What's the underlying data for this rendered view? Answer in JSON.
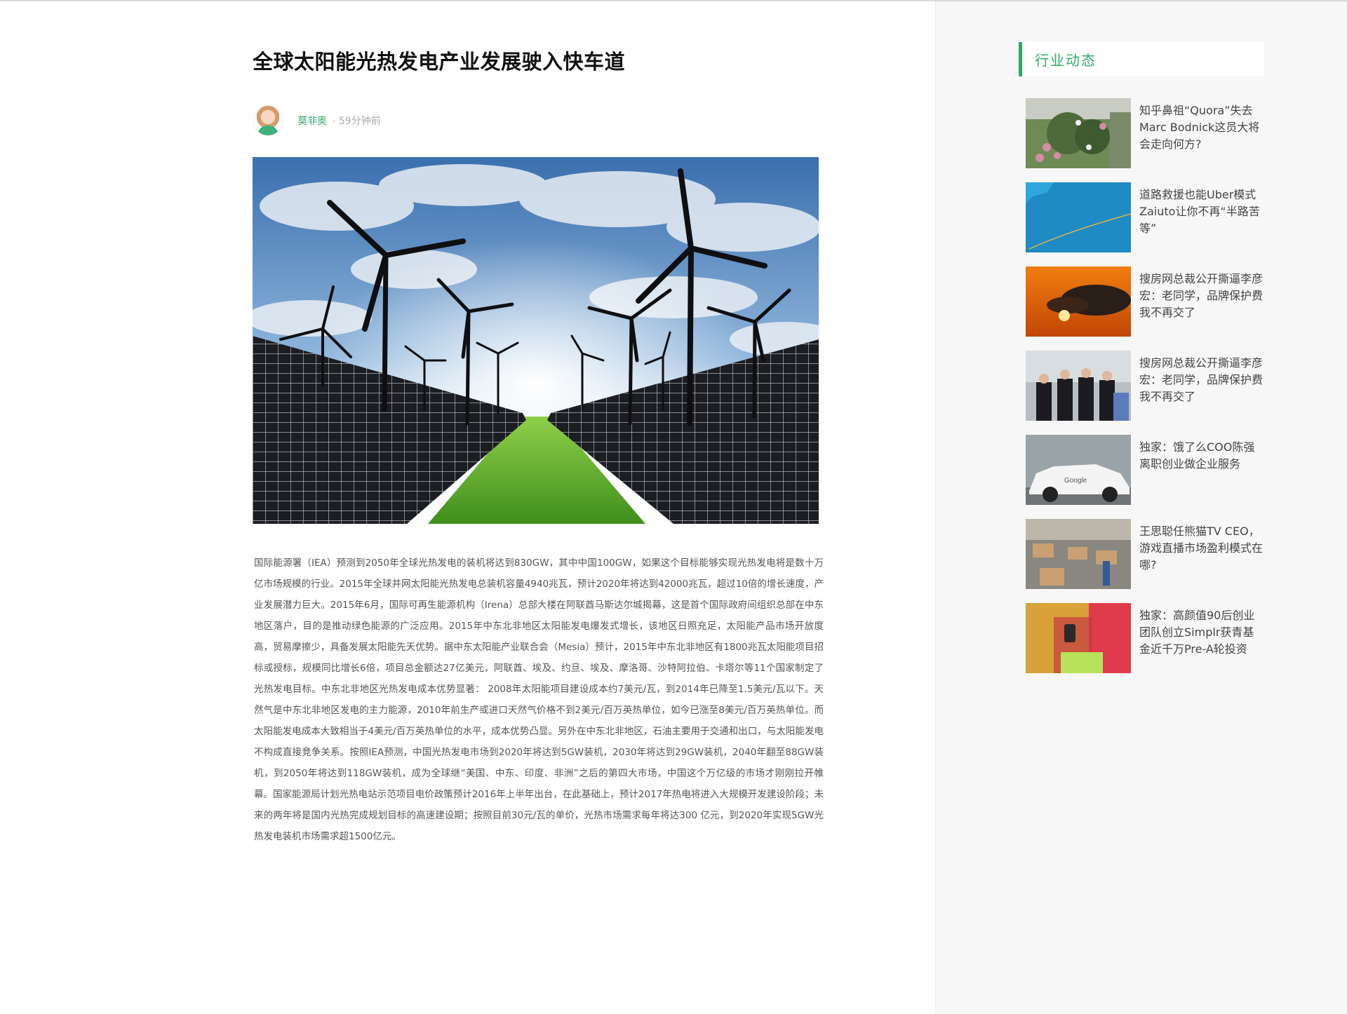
{
  "article": {
    "title": "全球太阳能光热发电产业发展驶入快车道",
    "author": "莫非奥",
    "time": "· 59分钟前",
    "body": "国际能源署（IEA）预测到2050年全球光热发电的装机将达到830GW，其中中国100GW，如果这个目标能够实现光热发电将是数十万亿市场规模的行业。2015年全球并网太阳能光热发电总装机容量4940兆瓦，预计2020年将达到42000兆瓦，超过10倍的增长速度，产业发展潜力巨大。2015年6月，国际可再生能源机构（Irena）总部大楼在阿联酋马斯达尔城揭幕，这是首个国际政府间组织总部在中东地区落户，目的是推动绿色能源的广泛应用。2015年中东北非地区太阳能发电爆发式增长，该地区日照充足，太阳能产品市场开放度高，贸易摩擦少，具备发展太阳能先天优势。据中东太阳能产业联合会（Mesia）预计，2015年中东北非地区有1800兆瓦太阳能项目招标或授标，规模同比增长6倍，项目总金额达27亿美元，阿联酋、埃及、约旦、埃及、摩洛哥、沙特阿拉伯、卡塔尔等11个国家制定了光热发电目标。中东北非地区光热发电成本优势显著： 2008年太阳能项目建设成本约7美元/瓦，到2014年已降至1.5美元/瓦以下。天然气是中东北非地区发电的主力能源，2010年前生产或进口天然气价格不到2美元/百万英热单位，如今已涨至8美元/百万英热单位。而太阳能发电成本大致相当于4美元/百万英热单位的水平，成本优势凸显。另外在中东北非地区，石油主要用于交通和出口，与太阳能发电不构成直接竞争关系。按照IEA预测，中国光热发电市场到2020年将达到5GW装机，2030年将达到29GW装机，2040年翻至88GW装机，到2050年将达到118GW装机，成为全球继“美国、中东、印度、非洲”之后的第四大市场，中国这个万亿级的市场才刚刚拉开帷幕。国家能源局计划光热电站示范项目电价政策预计2016年上半年出台，在此基础上，预计2017年热电将进入大规模开发建设阶段；未来的两年将是国内光热完成规划目标的高速建设期；按照目前30元/瓦的单价，光热市场需求每年将达300 亿元，到2020年实现5GW光热发电装机市场需求超1500亿元。"
  },
  "sidebar": {
    "section_title": "行业动态",
    "items": [
      {
        "title": "知乎鼻祖“Quora”失去Marc Bodnick这员大将会走向何方?",
        "thumb": "flowers"
      },
      {
        "title": "道路救援也能Uber模式 Zaiuto让你不再“半路苦等”",
        "thumb": "map-blue"
      },
      {
        "title": "搜房网总裁公开撕逼李彦宏：老同学，品牌保护费我不再交了",
        "thumb": "sunset"
      },
      {
        "title": "搜房网总裁公开撕逼李彦宏：老同学，品牌保护费我不再交了",
        "thumb": "group-photo"
      },
      {
        "title": "独家：饿了么COO陈强离职创业做企业服务",
        "thumb": "google-car"
      },
      {
        "title": "王思聪任熊猫TV CEO，游戏直播市场盈利模式在哪?",
        "thumb": "warehouse"
      },
      {
        "title": "独家：高颜值90后创业团队创立Simplr获青基金近千万Pre-A轮投资",
        "thumb": "shopping"
      }
    ]
  },
  "colors": {
    "accent": "#2eaa62",
    "sidebar_bg": "#f7f7f7"
  }
}
